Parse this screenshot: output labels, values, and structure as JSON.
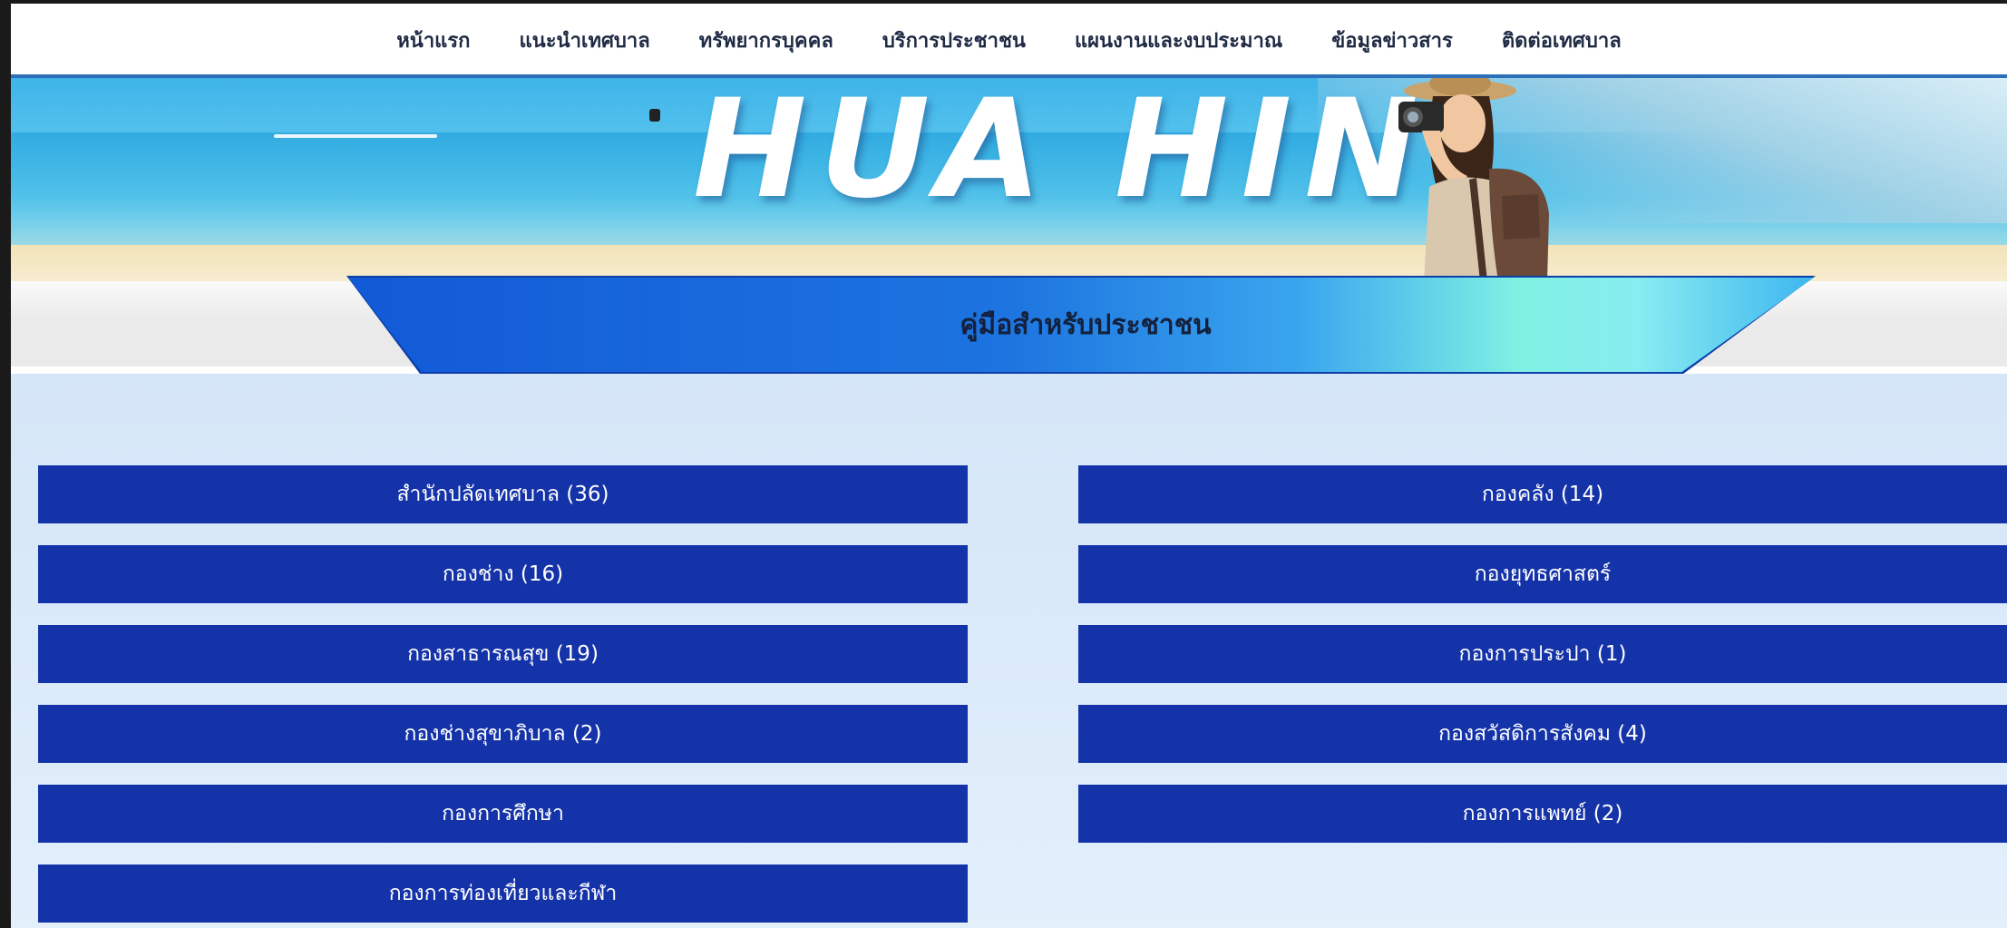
{
  "nav": {
    "items": [
      "หน้าแรก",
      "แนะนำเทศบาล",
      "ทรัพยากรบุคคล",
      "บริการประชาชน",
      "แผนงานและงบประมาณ",
      "ข้อมูลข่าวสาร",
      "ติดต่อเทศบาล"
    ]
  },
  "banner": {
    "title": "HUA HIN"
  },
  "section": {
    "title": "คู่มือสำหรับประชาชน"
  },
  "departments": {
    "left": [
      "สำนักปลัดเทศบาล (36)",
      "กองช่าง (16)",
      "กองสาธารณสุข (19)",
      "กองช่างสุขาภิบาล (2)",
      "กองการศึกษา",
      "กองการท่องเที่ยวและกีฬา"
    ],
    "right": [
      "กองคลัง (14)",
      "กองยุทธศาสตร์",
      "กองการประปา (1)",
      "กองสวัสดิการสังคม (4)",
      "กองการแพทย์ (2)"
    ]
  },
  "colors": {
    "nav_text": "#1f2a44",
    "nav_underline": "#2b6fb8",
    "button_bg": "#1533a8",
    "button_text": "#ffffff",
    "content_bg": "#d8e8f9"
  }
}
